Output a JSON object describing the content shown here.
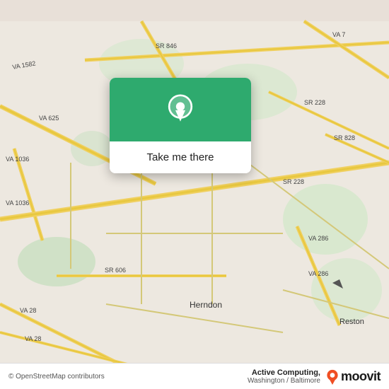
{
  "map": {
    "background_color": "#ede8e0",
    "attribution": "© OpenStreetMap contributors"
  },
  "popup": {
    "header_color": "#2eaa6e",
    "button_label": "Take me there"
  },
  "bottom_bar": {
    "app_name": "Active Computing,",
    "app_location": "Washington / Baltimore",
    "moovit_label": "moovit"
  },
  "roads": [
    {
      "label": "VA 1582"
    },
    {
      "label": "VA 625"
    },
    {
      "label": "SR 846"
    },
    {
      "label": "VA 7"
    },
    {
      "label": "SR 228"
    },
    {
      "label": "VA 1036"
    },
    {
      "label": "SR 606"
    },
    {
      "label": "VA 28"
    },
    {
      "label": "VA 286"
    },
    {
      "label": "SR 828"
    },
    {
      "label": "Herndon"
    },
    {
      "label": "Reston"
    }
  ]
}
